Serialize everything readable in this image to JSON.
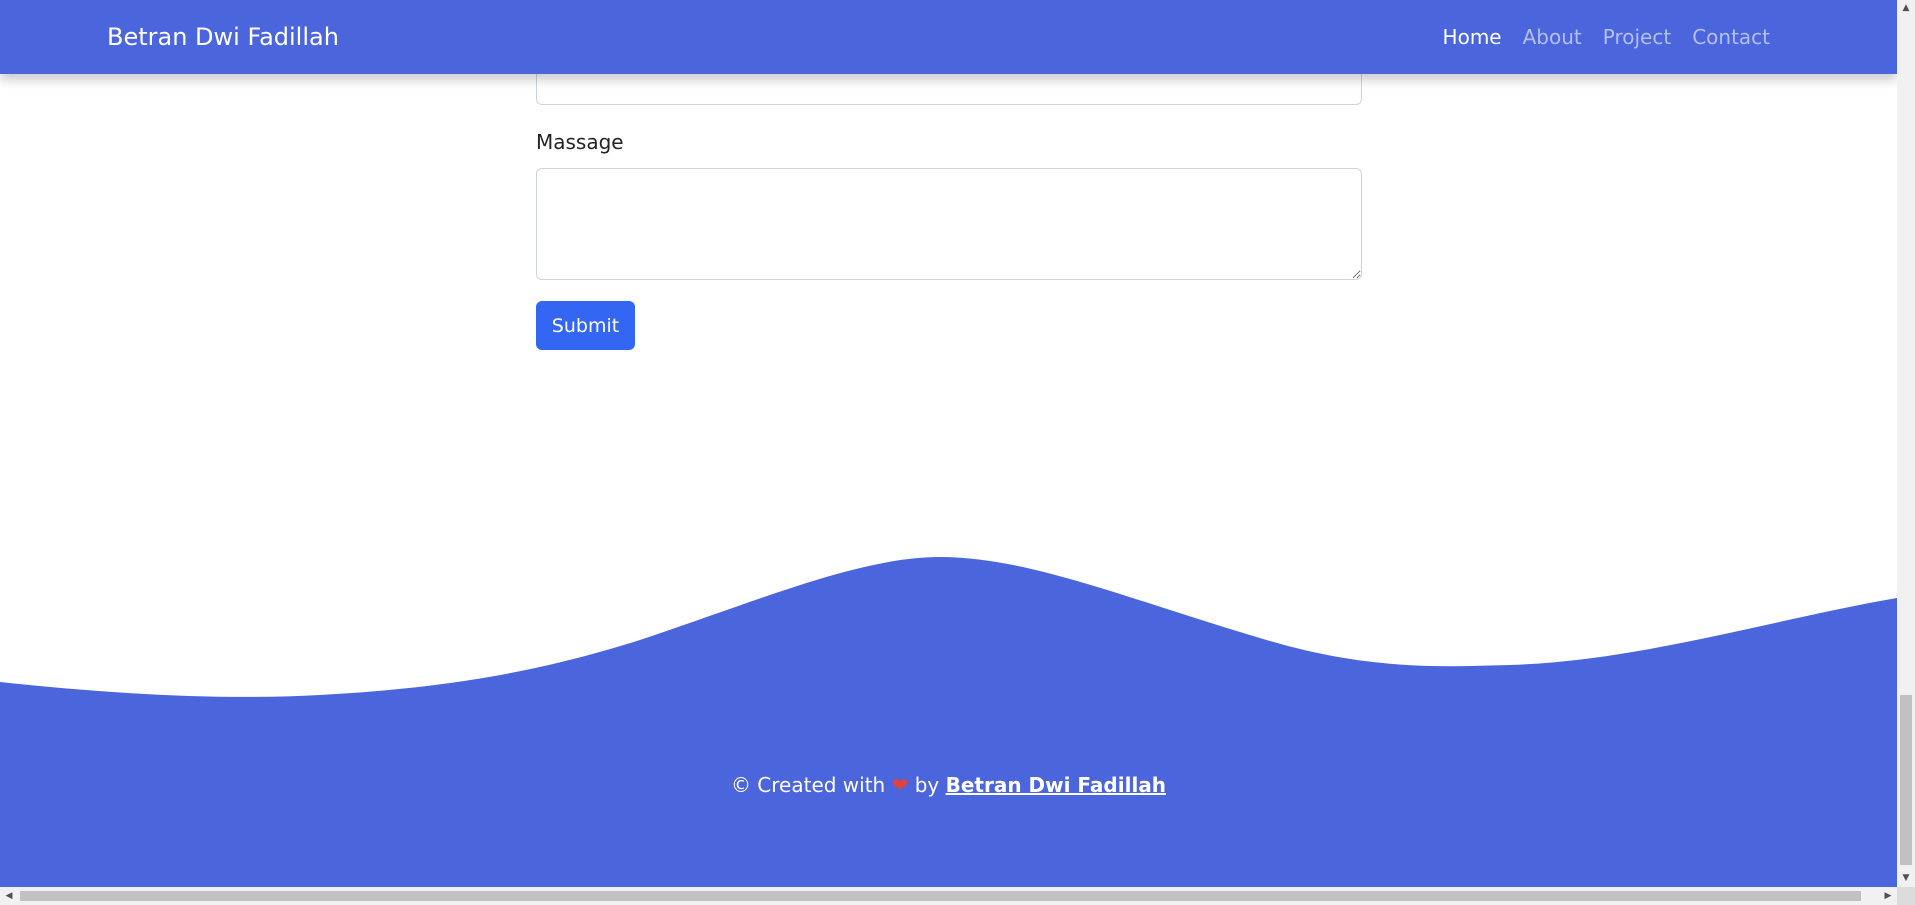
{
  "navbar": {
    "brand": "Betran Dwi Fadillah",
    "background_color": "#4b65dd",
    "links": [
      {
        "label": "Home",
        "active": true
      },
      {
        "label": "About",
        "active": false
      },
      {
        "label": "Project",
        "active": false
      },
      {
        "label": "Contact",
        "active": false
      }
    ]
  },
  "form": {
    "message_label": "Massage",
    "message_value": "",
    "submit_label": "Submit",
    "submit_color": "#3466f4"
  },
  "footer": {
    "prefix": "© Created with",
    "heart_icon": "heart-icon",
    "by": "by",
    "author": "Betran Dwi Fadillah",
    "background_color": "#4b65dd"
  }
}
